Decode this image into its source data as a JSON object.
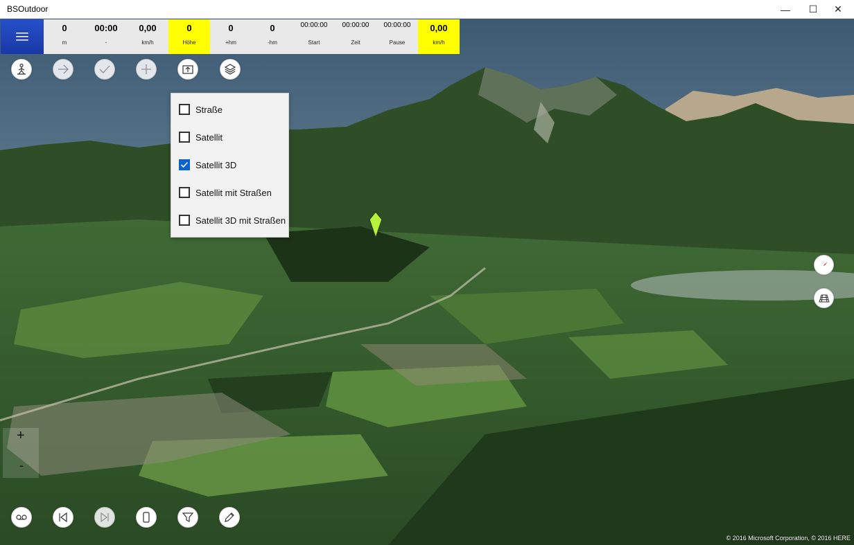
{
  "window": {
    "title": "BSOutdoor",
    "minimize_glyph": "—",
    "maximize_glyph": "☐",
    "close_glyph": "✕"
  },
  "stats": [
    {
      "value": "0",
      "unit": "m",
      "highlight": false
    },
    {
      "value": "00:00",
      "unit": "-",
      "highlight": false
    },
    {
      "value": "0,00",
      "unit": "km/h",
      "highlight": false
    },
    {
      "value": "0",
      "unit": "Höhe",
      "highlight": true
    },
    {
      "value": "0",
      "unit": "+hm",
      "highlight": false
    },
    {
      "value": "0",
      "unit": "-hm",
      "highlight": false
    },
    {
      "value": "00:00:00",
      "unit": "Start",
      "highlight": false
    },
    {
      "value": "00:00:00",
      "unit": "Zeit",
      "highlight": false
    },
    {
      "value": "00:00:00",
      "unit": "Pause",
      "highlight": false
    },
    {
      "value": "0,00",
      "unit": "km/h",
      "highlight": true
    }
  ],
  "top_tools": [
    {
      "icon": "hiker-icon"
    },
    {
      "icon": "arrow-right-icon"
    },
    {
      "icon": "checkmark-icon"
    },
    {
      "icon": "plus-icon"
    },
    {
      "icon": "upload-screen-icon"
    },
    {
      "icon": "layers-icon"
    }
  ],
  "layers_menu": {
    "options": [
      {
        "label": "Straße",
        "checked": false
      },
      {
        "label": "Satellit",
        "checked": false
      },
      {
        "label": "Satellit 3D",
        "checked": true
      },
      {
        "label": "Satellit mit Straßen",
        "checked": false
      },
      {
        "label": "Satellit 3D mit Straßen",
        "checked": false
      }
    ]
  },
  "zoom": {
    "plus": "+",
    "minus": "-"
  },
  "bottom_tools": [
    {
      "icon": "voicemail-icon"
    },
    {
      "icon": "skip-previous-icon"
    },
    {
      "icon": "skip-next-icon"
    },
    {
      "icon": "phone-device-icon"
    },
    {
      "icon": "filter-icon"
    },
    {
      "icon": "pencil-icon"
    }
  ],
  "map_controls": [
    {
      "icon": "compass-icon"
    },
    {
      "icon": "grid-tilt-icon"
    }
  ],
  "colors": {
    "menu_button": "#1f44b8",
    "stat_highlight": "#ffff00",
    "checkbox_checked": "#0a63c9",
    "marker": "#b7f23c"
  },
  "copyright": "© 2016 Microsoft Corporation, © 2016 HERE"
}
